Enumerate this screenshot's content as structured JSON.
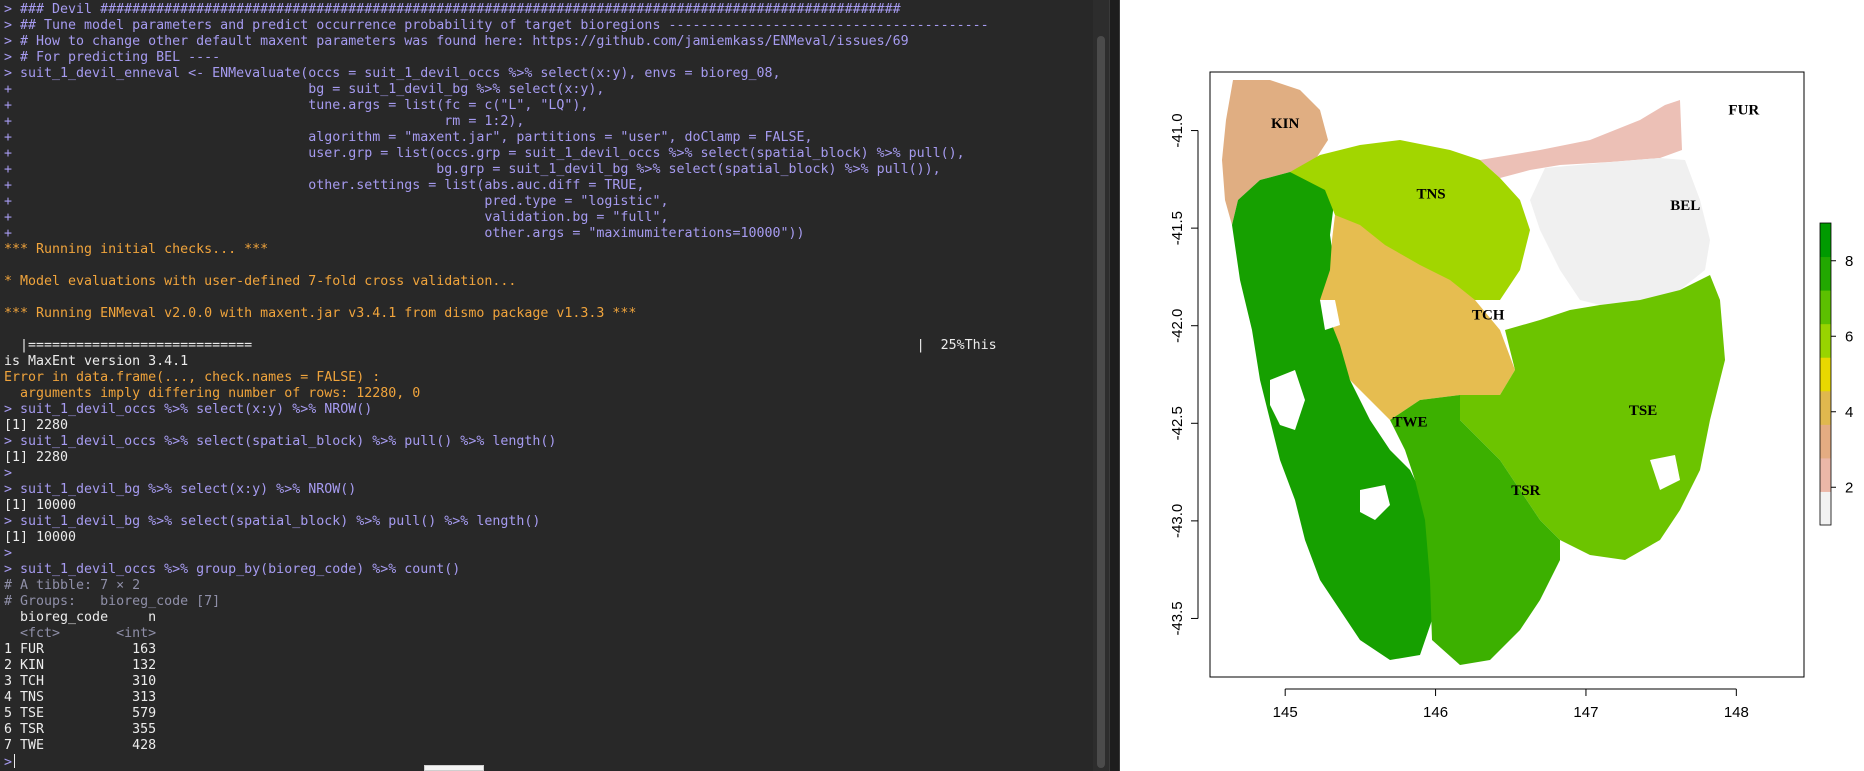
{
  "console": {
    "lines": [
      {
        "text": "> ### Devil ####################################################################################################",
        "kind": "in"
      },
      {
        "text": "> ## Tune model parameters and predict occurrence probability of target bioregions ----------------------------------------",
        "kind": "in"
      },
      {
        "text": "> # How to change other default maxent parameters was found here: https://github.com/jamiemkass/ENMeval/issues/69",
        "kind": "in"
      },
      {
        "text": "> # For predicting BEL ----",
        "kind": "in"
      },
      {
        "text": "> suit_1_devil_enneval <- ENMevaluate(occs = suit_1_devil_occs %>% select(x:y), envs = bioreg_08,",
        "kind": "in"
      },
      {
        "text": "+                                     bg = suit_1_devil_bg %>% select(x:y),",
        "kind": "in"
      },
      {
        "text": "+                                     tune.args = list(fc = c(\"L\", \"LQ\"),",
        "kind": "in"
      },
      {
        "text": "+                                                      rm = 1:2),",
        "kind": "in"
      },
      {
        "text": "+                                     algorithm = \"maxent.jar\", partitions = \"user\", doClamp = FALSE,",
        "kind": "in"
      },
      {
        "text": "+                                     user.grp = list(occs.grp = suit_1_devil_occs %>% select(spatial_block) %>% pull(),",
        "kind": "in"
      },
      {
        "text": "+                                                     bg.grp = suit_1_devil_bg %>% select(spatial_block) %>% pull()),",
        "kind": "in"
      },
      {
        "text": "+                                     other.settings = list(abs.auc.diff = TRUE,",
        "kind": "in"
      },
      {
        "text": "+                                                           pred.type = \"logistic\",",
        "kind": "in"
      },
      {
        "text": "+                                                           validation.bg = \"full\",",
        "kind": "in"
      },
      {
        "text": "+                                                           other.args = \"maximumiterations=10000\"))",
        "kind": "in"
      },
      {
        "text": "*** Running initial checks... ***",
        "kind": "msg"
      },
      {
        "text": "",
        "kind": "out"
      },
      {
        "text": "* Model evaluations with user-defined 7-fold cross validation...",
        "kind": "msg"
      },
      {
        "text": "",
        "kind": "out"
      },
      {
        "text": "*** Running ENMeval v2.0.0 with maxent.jar v3.4.1 from dismo package v1.3.3 ***",
        "kind": "msg"
      },
      {
        "text": "",
        "kind": "out"
      },
      {
        "text": "  |============================                                                                                   |  25%This",
        "kind": "out"
      },
      {
        "text": "is MaxEnt version 3.4.1",
        "kind": "out"
      },
      {
        "text": "Error in data.frame(..., check.names = FALSE) :",
        "kind": "msg"
      },
      {
        "text": "  arguments imply differing number of rows: 12280, 0",
        "kind": "msg"
      },
      {
        "text": "> suit_1_devil_occs %>% select(x:y) %>% NROW()",
        "kind": "in"
      },
      {
        "text": "[1] 2280",
        "kind": "out"
      },
      {
        "text": "> suit_1_devil_occs %>% select(spatial_block) %>% pull() %>% length()",
        "kind": "in"
      },
      {
        "text": "[1] 2280",
        "kind": "out"
      },
      {
        "text": ">",
        "kind": "in"
      },
      {
        "text": "> suit_1_devil_bg %>% select(x:y) %>% NROW()",
        "kind": "in"
      },
      {
        "text": "[1] 10000",
        "kind": "out"
      },
      {
        "text": "> suit_1_devil_bg %>% select(spatial_block) %>% pull() %>% length()",
        "kind": "in"
      },
      {
        "text": "[1] 10000",
        "kind": "out"
      },
      {
        "text": ">",
        "kind": "in"
      },
      {
        "text": "> suit_1_devil_occs %>% group_by(bioreg_code) %>% count()",
        "kind": "in"
      },
      {
        "text": "# A tibble: 7 × 2",
        "kind": "dim"
      },
      {
        "text": "# Groups:   bioreg_code [7]",
        "kind": "dim"
      },
      {
        "text": "  bioreg_code     n",
        "kind": "out"
      },
      {
        "text": "  <fct>       <int>",
        "kind": "dim"
      },
      {
        "text": "1 FUR           163",
        "kind": "out"
      },
      {
        "text": "2 KIN           132",
        "kind": "out"
      },
      {
        "text": "3 TCH           310",
        "kind": "out"
      },
      {
        "text": "4 TNS           313",
        "kind": "out"
      },
      {
        "text": "5 TSE           579",
        "kind": "out"
      },
      {
        "text": "6 TSR           355",
        "kind": "out"
      },
      {
        "text": "7 TWE           428",
        "kind": "out"
      }
    ],
    "prompt": ">"
  },
  "colors": {
    "console_bg": "#282828",
    "input": "#a69bf0",
    "message": "#f0a43c",
    "output": "#ececec"
  },
  "plot": {
    "x_ticks": [
      "145",
      "146",
      "147",
      "148"
    ],
    "y_ticks": [
      "-41.0",
      "-41.5",
      "-42.0",
      "-42.5",
      "-43.0",
      "-43.5"
    ],
    "legend_ticks": [
      "8",
      "6",
      "4",
      "2"
    ],
    "legend_range": [
      1,
      9
    ],
    "legend_colors": [
      "#f2f2f2",
      "#ebb7a8",
      "#e4ac82",
      "#e0b84e",
      "#e8d800",
      "#98d400",
      "#5cc000",
      "#22a800",
      "#009a00"
    ],
    "regions": [
      {
        "name": "FUR",
        "value": 1.5,
        "color": "#ecc0b6"
      },
      {
        "name": "KIN",
        "value": 3,
        "color": "#e0ae82"
      },
      {
        "name": "TCH",
        "value": 4,
        "color": "#e6bd50"
      },
      {
        "name": "TNS",
        "value": 6.5,
        "color": "#a2d600"
      },
      {
        "name": "TSE",
        "value": 7,
        "color": "#6cc400"
      },
      {
        "name": "TSR",
        "value": 8,
        "color": "#3cb000"
      },
      {
        "name": "TWE",
        "value": 8.5,
        "color": "#16a000"
      },
      {
        "name": "BEL",
        "value": 1,
        "color": "#f0f0f0"
      }
    ]
  }
}
